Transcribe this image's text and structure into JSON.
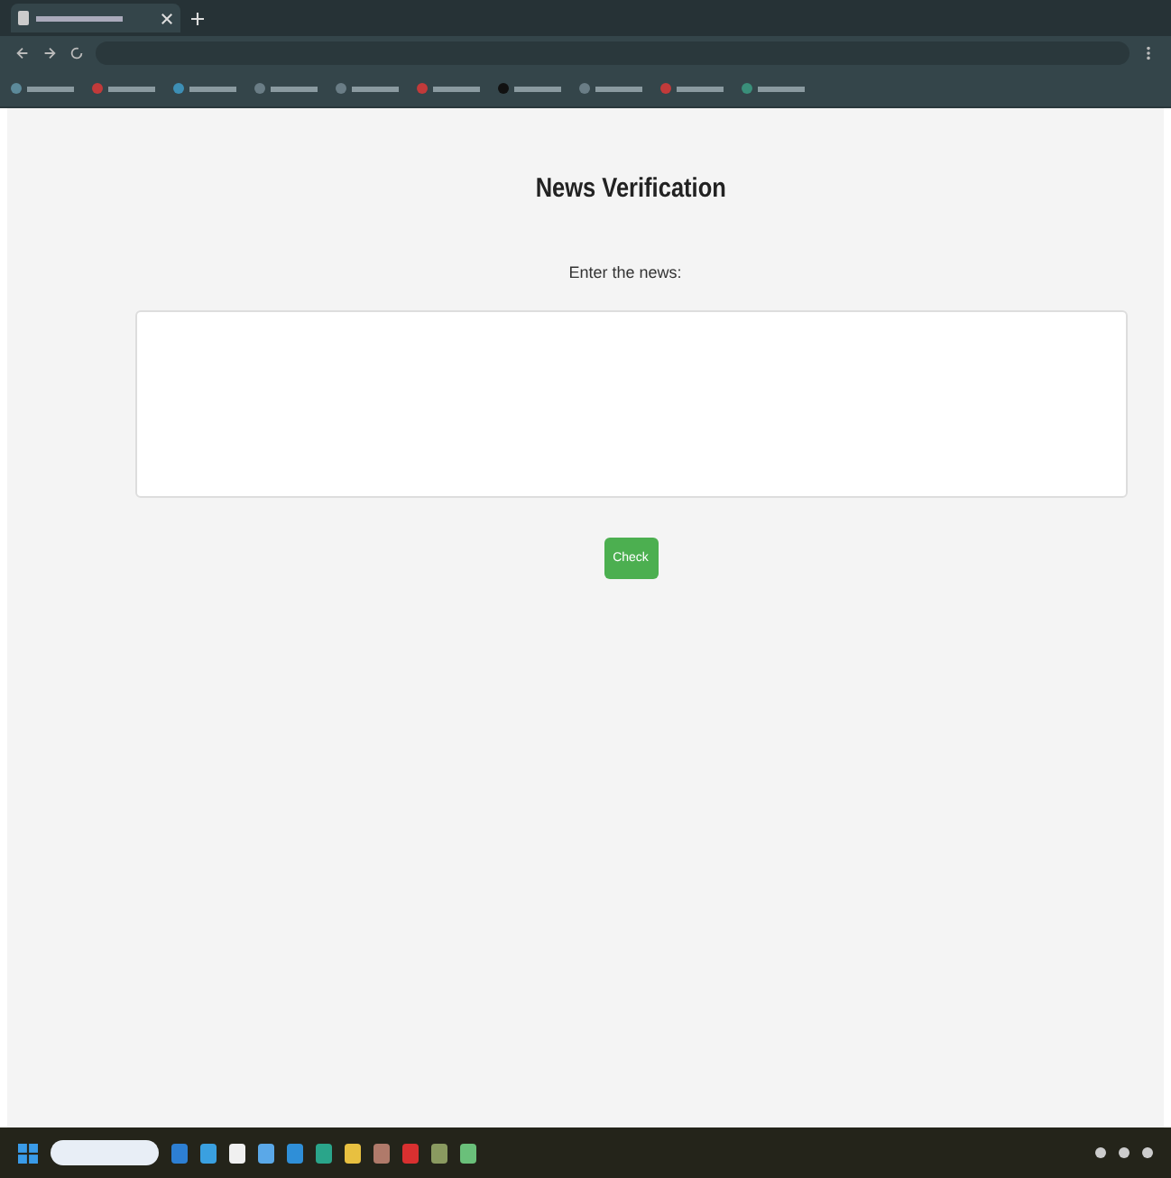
{
  "heading": "News Verification",
  "news_label": "Enter the news:",
  "submit_button": "Check"
}
